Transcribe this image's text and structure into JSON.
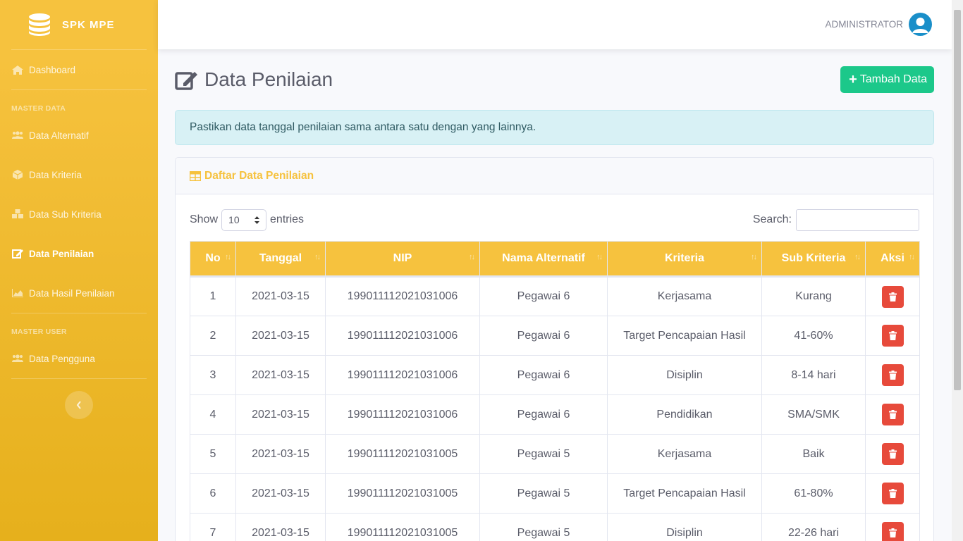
{
  "brand": {
    "name": "SPK MPE"
  },
  "sidebar": {
    "dashboard": "Dashboard",
    "section_master_data": "MASTER DATA",
    "items": [
      {
        "label": "Data Alternatif",
        "icon": "users-icon"
      },
      {
        "label": "Data Kriteria",
        "icon": "cube-icon"
      },
      {
        "label": "Data Sub Kriteria",
        "icon": "cubes-icon"
      },
      {
        "label": "Data Penilaian",
        "icon": "edit-icon",
        "active": true
      },
      {
        "label": "Data Hasil Penilaian",
        "icon": "chart-area-icon"
      }
    ],
    "section_master_user": "MASTER USER",
    "user_item": "Data Pengguna"
  },
  "topbar": {
    "user_name": "ADMINISTRATOR"
  },
  "page": {
    "title": "Data Penilaian",
    "add_button": "Tambah Data",
    "alert": "Pastikan data tanggal penilaian sama antara satu dengan yang lainnya."
  },
  "card": {
    "title": "Daftar Data Penilaian"
  },
  "table_controls": {
    "show_label": "Show",
    "entries_value": "10",
    "entries_label": "entries",
    "search_label": "Search:"
  },
  "table": {
    "columns": [
      "No",
      "Tanggal",
      "NIP",
      "Nama Alternatif",
      "Kriteria",
      "Sub Kriteria",
      "Aksi"
    ],
    "rows": [
      [
        "1",
        "2021-03-15",
        "199011112021031006",
        "Pegawai 6",
        "Kerjasama",
        "Kurang"
      ],
      [
        "2",
        "2021-03-15",
        "199011112021031006",
        "Pegawai 6",
        "Target Pencapaian Hasil",
        "41-60%"
      ],
      [
        "3",
        "2021-03-15",
        "199011112021031006",
        "Pegawai 6",
        "Disiplin",
        "8-14 hari"
      ],
      [
        "4",
        "2021-03-15",
        "199011112021031006",
        "Pegawai 6",
        "Pendidikan",
        "SMA/SMK"
      ],
      [
        "5",
        "2021-03-15",
        "199011112021031005",
        "Pegawai 5",
        "Kerjasama",
        "Baik"
      ],
      [
        "6",
        "2021-03-15",
        "199011112021031005",
        "Pegawai 5",
        "Target Pencapaian Hasil",
        "61-80%"
      ],
      [
        "7",
        "2021-03-15",
        "199011112021031005",
        "Pegawai 5",
        "Disiplin",
        "22-26 hari"
      ]
    ]
  },
  "colors": {
    "primary": "#f6c23e",
    "success": "#1cc88a",
    "danger": "#e74a3b",
    "info_bg": "#d8f1f5"
  }
}
